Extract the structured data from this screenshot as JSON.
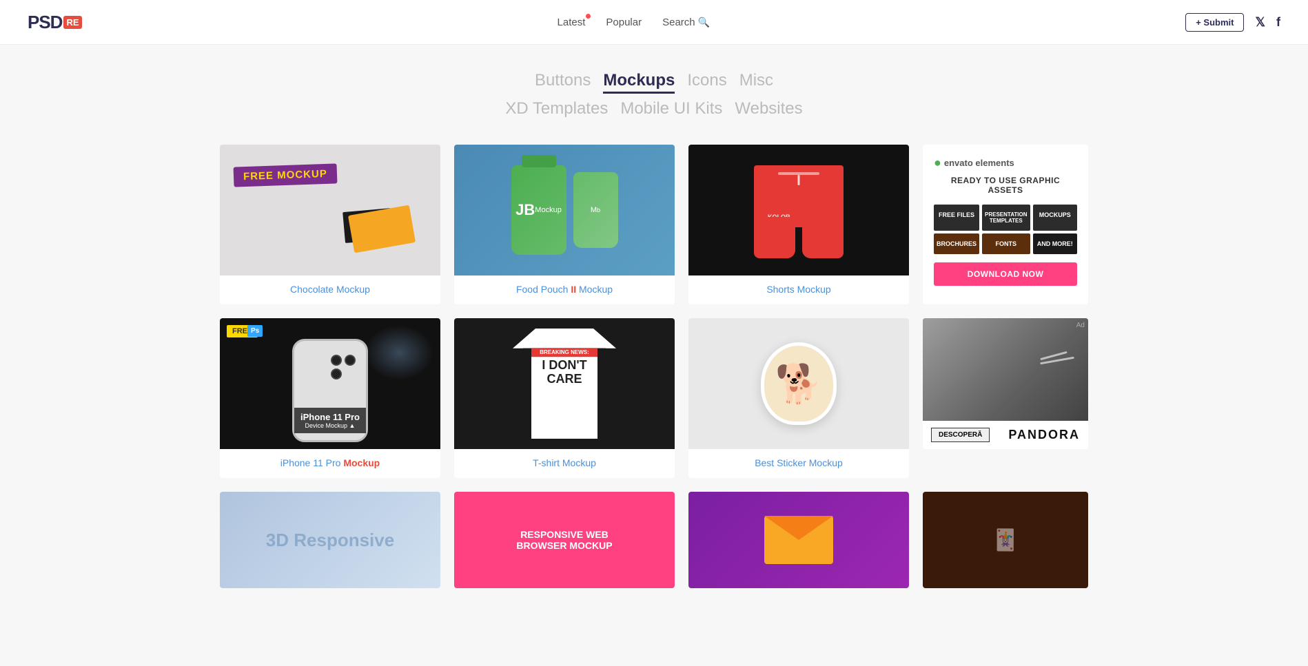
{
  "header": {
    "logo_psd": "PSD",
    "logo_re": "RE",
    "nav": {
      "latest": "Latest",
      "popular": "Popular",
      "search": "Search",
      "submit": "+ Submit"
    },
    "social": {
      "twitter": "🐦",
      "facebook": "f"
    }
  },
  "categories": {
    "row1": [
      "Buttons",
      "Mockups",
      "Icons",
      "Misc"
    ],
    "row2": [
      "XD Templates",
      "Mobile UI Kits",
      "Websites"
    ],
    "active": "Mockups"
  },
  "grid_row1": {
    "cards": [
      {
        "id": "chocolate",
        "badge": "FREE MOCKUP",
        "title_link": "Chocolate Mockup",
        "title_color": "blue"
      },
      {
        "id": "food-pouch",
        "title_part1": "Food Pouch ",
        "title_highlight": "II",
        "title_part2": " Mockup",
        "title_color": "blue"
      },
      {
        "id": "shorts",
        "title_link": "Shorts Mockup",
        "title_color": "blue"
      }
    ],
    "ad": {
      "logo": "envato elements",
      "tagline": "READY TO USE GRAPHIC ASSETS",
      "cells": [
        "FREE FILES",
        "PRESENTATION\nTEMPLATES",
        "MOCKUPS",
        "BROCHURES",
        "FONTS",
        "AND MORE!"
      ],
      "cta": "DOWNLOAD NOW"
    }
  },
  "grid_row2": {
    "cards": [
      {
        "id": "iphone",
        "badge": "FREE",
        "title_part1": "iPhone 11 Pro ",
        "title_highlight": "",
        "title_link": "Mockup",
        "title_color": "blue",
        "label": "iPhone 11 Pro",
        "subtitle": "Device Mockup"
      },
      {
        "id": "tshirt",
        "title_link": "T-shirt Mockup",
        "title_color": "blue",
        "breaking": "BREAKING NEWS:",
        "idc": "I DON'T\nCARE"
      },
      {
        "id": "sticker",
        "title_link": "Best Sticker Mockup",
        "title_color": "blue"
      }
    ],
    "ad": {
      "discover": "DESCOPERĂ",
      "brand": "PANDORA"
    }
  },
  "grid_row3": {
    "cards": [
      {
        "id": "3d-responsive",
        "label": "3D Responsive"
      },
      {
        "id": "browser-mockup",
        "line1": "RESPONSIVE WEB",
        "line2": "BROWSER MOCKUP"
      },
      {
        "id": "envelope"
      }
    ]
  }
}
